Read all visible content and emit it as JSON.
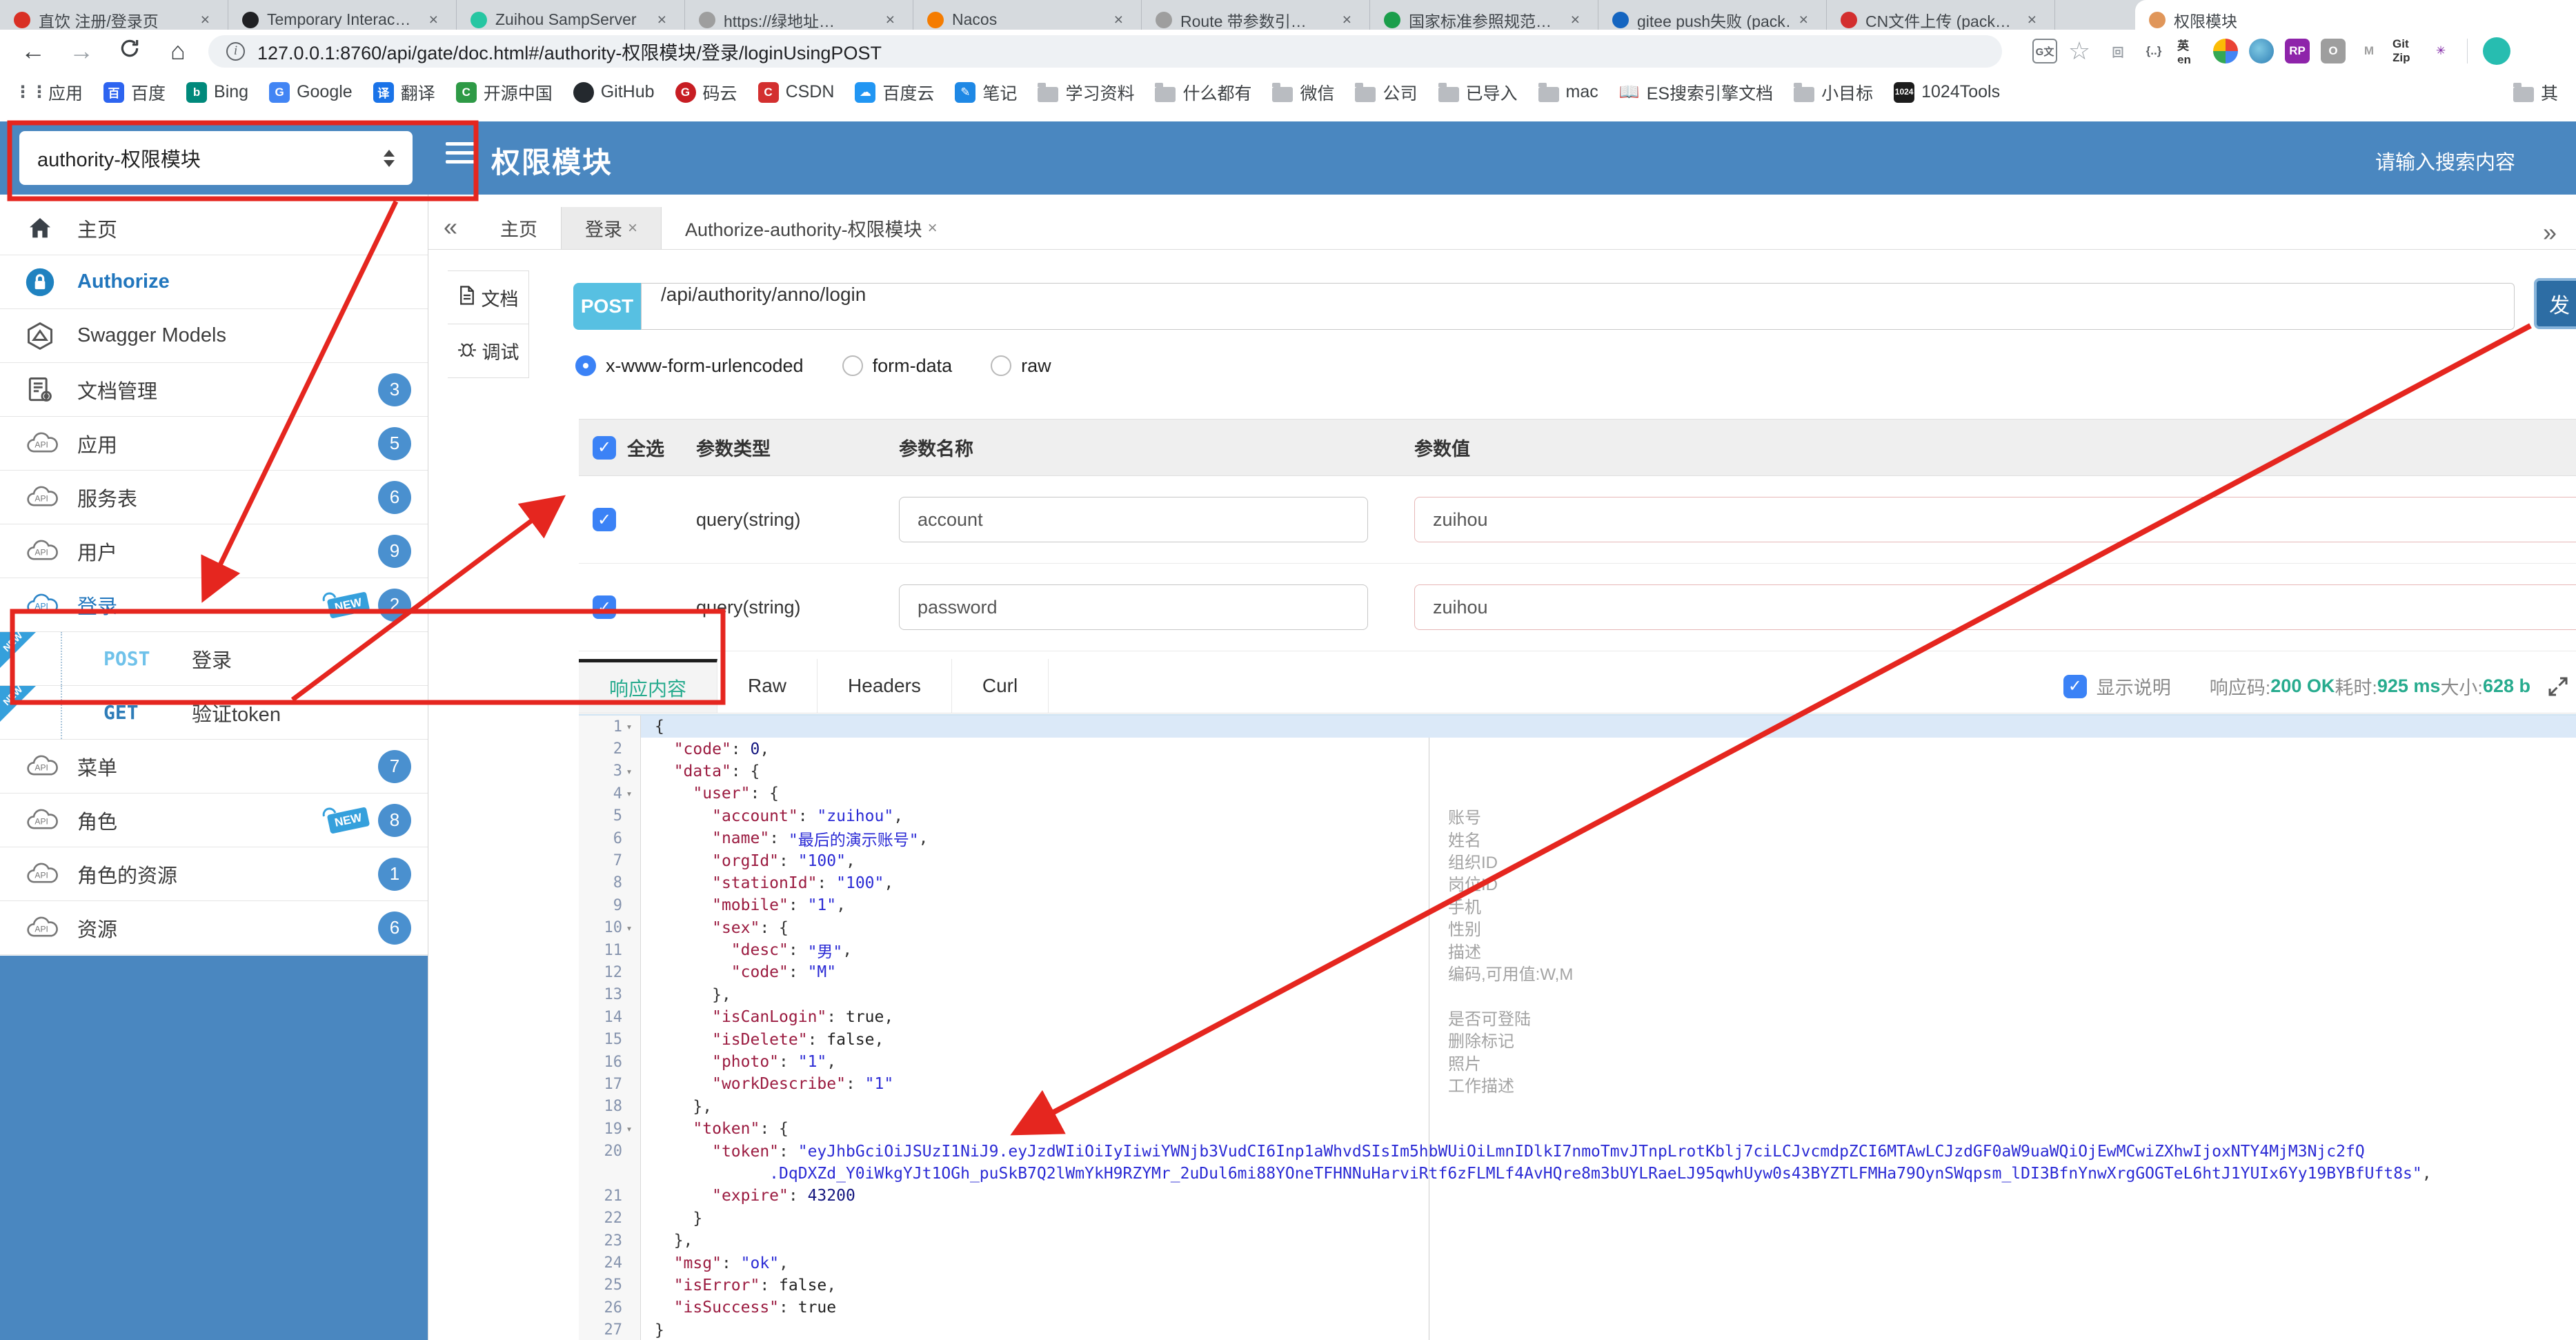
{
  "browser": {
    "tabs": [
      {
        "label": "直饮 注册/登录页",
        "color": "#d93025"
      },
      {
        "label": "Temporary Interac…",
        "color": "#202124"
      },
      {
        "label": "Zuihou SampServer",
        "color": "#26c6a2"
      },
      {
        "label": "https://绿地址…",
        "color": "#9e9e9e"
      },
      {
        "label": "Nacos",
        "color": "#f57c00"
      },
      {
        "label": "Route 带参数引…",
        "color": "#9e9e9e"
      },
      {
        "label": "国家标准参照规范…",
        "color": "#1b9e4b"
      },
      {
        "label": "gitee push失败 (pack…",
        "color": "#1565c0"
      },
      {
        "label": "CN文件上传 (pack…",
        "color": "#d32f2f"
      }
    ],
    "active_tab": {
      "label": "权限模块",
      "color": "#e0965a"
    },
    "close_glyph": "×",
    "url": "127.0.0.1:8760/api/gate/doc.html#/authority-权限模块/登录/loginUsingPOST",
    "bookmarks": [
      {
        "label": "应用",
        "icon": "apps-icon"
      },
      {
        "label": "百度",
        "icon": "baidu-icon"
      },
      {
        "label": "Bing",
        "icon": "bing-icon"
      },
      {
        "label": "Google",
        "icon": "google-icon"
      },
      {
        "label": "翻译",
        "icon": "translate-icon"
      },
      {
        "label": "开源中国",
        "icon": "osc-icon"
      },
      {
        "label": "GitHub",
        "icon": "github-icon"
      },
      {
        "label": "码云",
        "icon": "gitee-icon"
      },
      {
        "label": "CSDN",
        "icon": "csdn-icon"
      },
      {
        "label": "百度云",
        "icon": "baiduyun-icon"
      },
      {
        "label": "笔记",
        "icon": "note-icon"
      },
      {
        "label": "学习资料",
        "icon": "folder-icon"
      },
      {
        "label": "什么都有",
        "icon": "folder-icon"
      },
      {
        "label": "微信",
        "icon": "folder-icon"
      },
      {
        "label": "公司",
        "icon": "folder-icon"
      },
      {
        "label": "已导入",
        "icon": "folder-icon"
      },
      {
        "label": "mac",
        "icon": "folder-icon"
      },
      {
        "label": "ES搜索引擎文档",
        "icon": "book-icon"
      },
      {
        "label": "小目标",
        "icon": "folder-icon"
      },
      {
        "label": "1024Tools",
        "icon": "tools1024-icon"
      }
    ],
    "bookmarks_overflow": "其",
    "extensions": [
      "notion-icon",
      "braces-icon",
      "en-translate-icon",
      "chrome-icon",
      "globe-icon",
      "rp-icon",
      "ring-icon",
      "m-arrow-icon",
      "gitzip-icon",
      "asterisk-icon"
    ]
  },
  "header": {
    "module_select": "authority-权限模块",
    "title": "权限模块",
    "search_placeholder": "请输入搜索内容"
  },
  "sidebar": {
    "items": [
      {
        "label": "主页",
        "icon": "home-icon"
      },
      {
        "label": "Authorize",
        "icon": "lock-icon",
        "style": "link"
      },
      {
        "label": "Swagger Models",
        "icon": "hexagon-icon"
      },
      {
        "label": "文档管理",
        "icon": "doc-gear-icon",
        "badge": "3"
      },
      {
        "label": "应用",
        "icon": "cloud-api-icon",
        "badge": "5"
      },
      {
        "label": "服务表",
        "icon": "cloud-api-icon",
        "badge": "6"
      },
      {
        "label": "用户",
        "icon": "cloud-api-icon",
        "badge": "9"
      },
      {
        "label": "登录",
        "icon": "cloud-api-icon",
        "badge": "2",
        "new": true,
        "style": "sel"
      },
      {
        "type": "sub",
        "method": "POST",
        "label": "登录",
        "new": true
      },
      {
        "type": "sub",
        "method": "GET",
        "label": "验证token",
        "new": true
      },
      {
        "label": "菜单",
        "icon": "cloud-api-icon",
        "badge": "7"
      },
      {
        "label": "角色",
        "icon": "cloud-api-icon",
        "badge": "8",
        "new": true
      },
      {
        "label": "角色的资源",
        "icon": "cloud-api-icon",
        "badge": "1"
      },
      {
        "label": "资源",
        "icon": "cloud-api-icon",
        "badge": "6"
      }
    ]
  },
  "content_tabs": {
    "collapse": "«",
    "more": "»",
    "tabs": [
      {
        "label": "主页",
        "closable": false,
        "active": false
      },
      {
        "label": "登录",
        "closable": true,
        "active": true
      },
      {
        "label": "Authorize-authority-权限模块",
        "closable": true,
        "active": false
      }
    ]
  },
  "doc_nav": [
    {
      "label": "文档",
      "icon": "document-icon"
    },
    {
      "label": "调试",
      "icon": "bug-icon"
    }
  ],
  "request": {
    "method": "POST",
    "url": "/api/authority/anno/login",
    "send_label": "发",
    "body_types": [
      "x-www-form-urlencoded",
      "form-data",
      "raw"
    ],
    "selected_body_type": "x-www-form-urlencoded"
  },
  "param_table": {
    "select_all": "全选",
    "headers": [
      "参数类型",
      "参数名称",
      "参数值"
    ],
    "rows": [
      {
        "checked": true,
        "type": "query(string)",
        "name": "account",
        "value": "zuihou"
      },
      {
        "checked": true,
        "type": "query(string)",
        "name": "password",
        "value": "zuihou"
      }
    ]
  },
  "response": {
    "tabs": [
      "响应内容",
      "Raw",
      "Headers",
      "Curl"
    ],
    "active_tab": "响应内容",
    "show_desc_label": "显示说明",
    "show_desc_checked": true,
    "status_label": "响应码:",
    "status_value": "200 OK",
    "time_label": "耗时:",
    "time_value": "925 ms",
    "size_label": "大小:",
    "size_value": "628 b"
  },
  "editor": {
    "lines": [
      {
        "n": "1",
        "fold": true,
        "seg": [
          [
            "{",
            "p"
          ]
        ]
      },
      {
        "n": "2",
        "seg": [
          [
            "  ",
            "p"
          ],
          [
            "\"code\"",
            "k"
          ],
          [
            ": ",
            "p"
          ],
          [
            "0",
            "n"
          ],
          [
            ",",
            "p"
          ]
        ]
      },
      {
        "n": "3",
        "fold": true,
        "seg": [
          [
            "  ",
            "p"
          ],
          [
            "\"data\"",
            "k"
          ],
          [
            ": {",
            "p"
          ]
        ]
      },
      {
        "n": "4",
        "fold": true,
        "seg": [
          [
            "    ",
            "p"
          ],
          [
            "\"user\"",
            "k"
          ],
          [
            ": {",
            "p"
          ]
        ]
      },
      {
        "n": "5",
        "desc": "账号",
        "seg": [
          [
            "      ",
            "p"
          ],
          [
            "\"account\"",
            "k"
          ],
          [
            ": ",
            "p"
          ],
          [
            "\"zuihou\"",
            "s"
          ],
          [
            ",",
            "p"
          ]
        ]
      },
      {
        "n": "6",
        "desc": "姓名",
        "seg": [
          [
            "      ",
            "p"
          ],
          [
            "\"name\"",
            "k"
          ],
          [
            ": ",
            "p"
          ],
          [
            "\"最后的演示账号\"",
            "s"
          ],
          [
            ",",
            "p"
          ]
        ]
      },
      {
        "n": "7",
        "desc": "组织ID",
        "seg": [
          [
            "      ",
            "p"
          ],
          [
            "\"orgId\"",
            "k"
          ],
          [
            ": ",
            "p"
          ],
          [
            "\"100\"",
            "s"
          ],
          [
            ",",
            "p"
          ]
        ]
      },
      {
        "n": "8",
        "desc": "岗位ID",
        "seg": [
          [
            "      ",
            "p"
          ],
          [
            "\"stationId\"",
            "k"
          ],
          [
            ": ",
            "p"
          ],
          [
            "\"100\"",
            "s"
          ],
          [
            ",",
            "p"
          ]
        ]
      },
      {
        "n": "9",
        "desc": "手机",
        "seg": [
          [
            "      ",
            "p"
          ],
          [
            "\"mobile\"",
            "k"
          ],
          [
            ": ",
            "p"
          ],
          [
            "\"1\"",
            "s"
          ],
          [
            ",",
            "p"
          ]
        ]
      },
      {
        "n": "10",
        "fold": true,
        "desc": "性别",
        "seg": [
          [
            "      ",
            "p"
          ],
          [
            "\"sex\"",
            "k"
          ],
          [
            ": {",
            "p"
          ]
        ]
      },
      {
        "n": "11",
        "desc": "描述",
        "seg": [
          [
            "        ",
            "p"
          ],
          [
            "\"desc\"",
            "k"
          ],
          [
            ": ",
            "p"
          ],
          [
            "\"男\"",
            "s"
          ],
          [
            ",",
            "p"
          ]
        ]
      },
      {
        "n": "12",
        "desc": "编码,可用值:W,M",
        "seg": [
          [
            "        ",
            "p"
          ],
          [
            "\"code\"",
            "k"
          ],
          [
            ": ",
            "p"
          ],
          [
            "\"M\"",
            "s"
          ]
        ]
      },
      {
        "n": "13",
        "seg": [
          [
            "      },",
            "p"
          ]
        ]
      },
      {
        "n": "14",
        "desc": "是否可登陆",
        "seg": [
          [
            "      ",
            "p"
          ],
          [
            "\"isCanLogin\"",
            "k"
          ],
          [
            ": ",
            "p"
          ],
          [
            "true",
            "b"
          ],
          [
            ",",
            "p"
          ]
        ]
      },
      {
        "n": "15",
        "desc": "删除标记",
        "seg": [
          [
            "      ",
            "p"
          ],
          [
            "\"isDelete\"",
            "k"
          ],
          [
            ": ",
            "p"
          ],
          [
            "false",
            "b"
          ],
          [
            ",",
            "p"
          ]
        ]
      },
      {
        "n": "16",
        "desc": "照片",
        "seg": [
          [
            "      ",
            "p"
          ],
          [
            "\"photo\"",
            "k"
          ],
          [
            ": ",
            "p"
          ],
          [
            "\"1\"",
            "s"
          ],
          [
            ",",
            "p"
          ]
        ]
      },
      {
        "n": "17",
        "desc": "工作描述",
        "seg": [
          [
            "      ",
            "p"
          ],
          [
            "\"workDescribe\"",
            "k"
          ],
          [
            ": ",
            "p"
          ],
          [
            "\"1\"",
            "s"
          ]
        ]
      },
      {
        "n": "18",
        "seg": [
          [
            "    },",
            "p"
          ]
        ]
      },
      {
        "n": "19",
        "fold": true,
        "seg": [
          [
            "    ",
            "p"
          ],
          [
            "\"token\"",
            "k"
          ],
          [
            ": {",
            "p"
          ]
        ]
      },
      {
        "n": "20",
        "seg": [
          [
            "      ",
            "p"
          ],
          [
            "\"token\"",
            "k"
          ],
          [
            ": ",
            "p"
          ],
          [
            "\"eyJhbGciOiJSUzI1NiJ9.eyJzdWIiOiIyIiwiYWNjb3VudCI6Inp1aWhvdSIsIm5hbWUiOiLmnIDlkI7nmoTmvJTnpLrotKblj7ciLCJvcmdpZCI6MTAwLCJzdGF0aW9uaWQiOjEwMCwiZXhwIjoxNTY4MjM3Njc2fQ",
            "s"
          ]
        ]
      },
      {
        "n": "",
        "seg": [
          [
            "            ",
            "p"
          ],
          [
            ".DqDXZd_Y0iWkgYJt1OGh_puSkB7Q2lWmYkH9RZYMr_2uDul6mi88YOneTFHNNuHarviRtf6zFLMLf4AvHQre8m3bUYLRaeLJ95qwhUyw0s43BYZTLFMHa79OynSWqpsm_lDI3BfnYnwXrgGOGTeL6htJ1YUIx6Yy19BYBfUft8s\"",
            "s"
          ],
          [
            ",",
            "p"
          ]
        ]
      },
      {
        "n": "21",
        "seg": [
          [
            "      ",
            "p"
          ],
          [
            "\"expire\"",
            "k"
          ],
          [
            ": ",
            "p"
          ],
          [
            "43200",
            "n"
          ]
        ]
      },
      {
        "n": "22",
        "seg": [
          [
            "    }",
            "p"
          ]
        ]
      },
      {
        "n": "23",
        "seg": [
          [
            "  },",
            "p"
          ]
        ]
      },
      {
        "n": "24",
        "seg": [
          [
            "  ",
            "p"
          ],
          [
            "\"msg\"",
            "k"
          ],
          [
            ": ",
            "p"
          ],
          [
            "\"ok\"",
            "s"
          ],
          [
            ",",
            "p"
          ]
        ]
      },
      {
        "n": "25",
        "seg": [
          [
            "  ",
            "p"
          ],
          [
            "\"isError\"",
            "k"
          ],
          [
            ": ",
            "p"
          ],
          [
            "false",
            "b"
          ],
          [
            ",",
            "p"
          ]
        ]
      },
      {
        "n": "26",
        "seg": [
          [
            "  ",
            "p"
          ],
          [
            "\"isSuccess\"",
            "k"
          ],
          [
            ": ",
            "p"
          ],
          [
            "true",
            "b"
          ]
        ]
      },
      {
        "n": "27",
        "seg": [
          [
            "}",
            "p"
          ]
        ]
      }
    ]
  },
  "annotations": {
    "color": "#e5261f"
  }
}
